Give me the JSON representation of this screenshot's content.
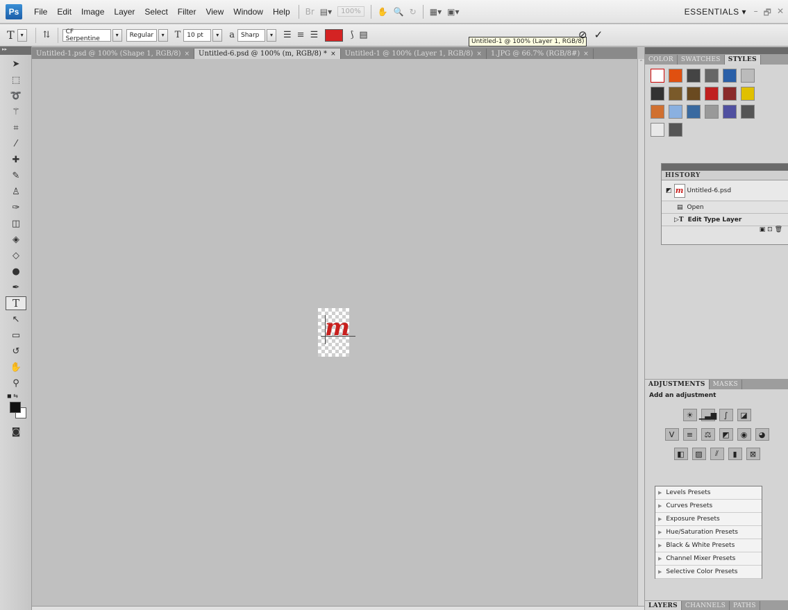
{
  "app": {
    "logo": "Ps"
  },
  "menu": {
    "items": [
      "File",
      "Edit",
      "Image",
      "Layer",
      "Select",
      "Filter",
      "View",
      "Window",
      "Help"
    ],
    "zoom": "100%",
    "workspace": "ESSENTIALS ▾",
    "window_controls": [
      "–",
      "🗗",
      "✕"
    ]
  },
  "options": {
    "tool_glyph": "T",
    "font_family": "CF Serpentine",
    "font_style": "Regular",
    "font_size": "10 pt",
    "aa_label": "a",
    "antialias": "Sharp",
    "text_color": "#d42323",
    "tooltip": "Untitled-1 @ 100% (Layer 1, RGB/8)",
    "cancel_glyph": "⊘",
    "commit_glyph": "✓"
  },
  "tabs": [
    {
      "label": "Untitled-1.psd @ 100% (Shape 1, RGB/8)",
      "close": "×"
    },
    {
      "label": "Untitled-6.psd @ 100% (m, RGB/8) *",
      "close": "×"
    },
    {
      "label": "Untitled-1 @ 100% (Layer 1, RGB/8)",
      "close": "×"
    },
    {
      "label": "1.JPG @ 66.7% (RGB/8#)",
      "close": "×"
    }
  ],
  "canvas": {
    "glyph": "m",
    "glyph_color": "#c8201e"
  },
  "panels": {
    "top_tabs": [
      "COLOR",
      "SWATCHES",
      "STYLES"
    ],
    "history": {
      "title": "HISTORY",
      "snapshot": "Untitled-6.psd",
      "items": [
        "Open",
        "Edit Type Layer"
      ]
    },
    "adjustments": {
      "tabs": [
        "ADJUSTMENTS",
        "MASKS"
      ],
      "title": "Add an adjustment",
      "presets": [
        "Levels Presets",
        "Curves Presets",
        "Exposure Presets",
        "Hue/Saturation Presets",
        "Black & White Presets",
        "Channel Mixer Presets",
        "Selective Color Presets"
      ]
    },
    "layers_tabs": [
      "LAYERS",
      "CHANNELS",
      "PATHS"
    ]
  },
  "colors": {
    "accent": "#1c5ea8",
    "foreground": "#111111",
    "background": "#ffffff"
  }
}
